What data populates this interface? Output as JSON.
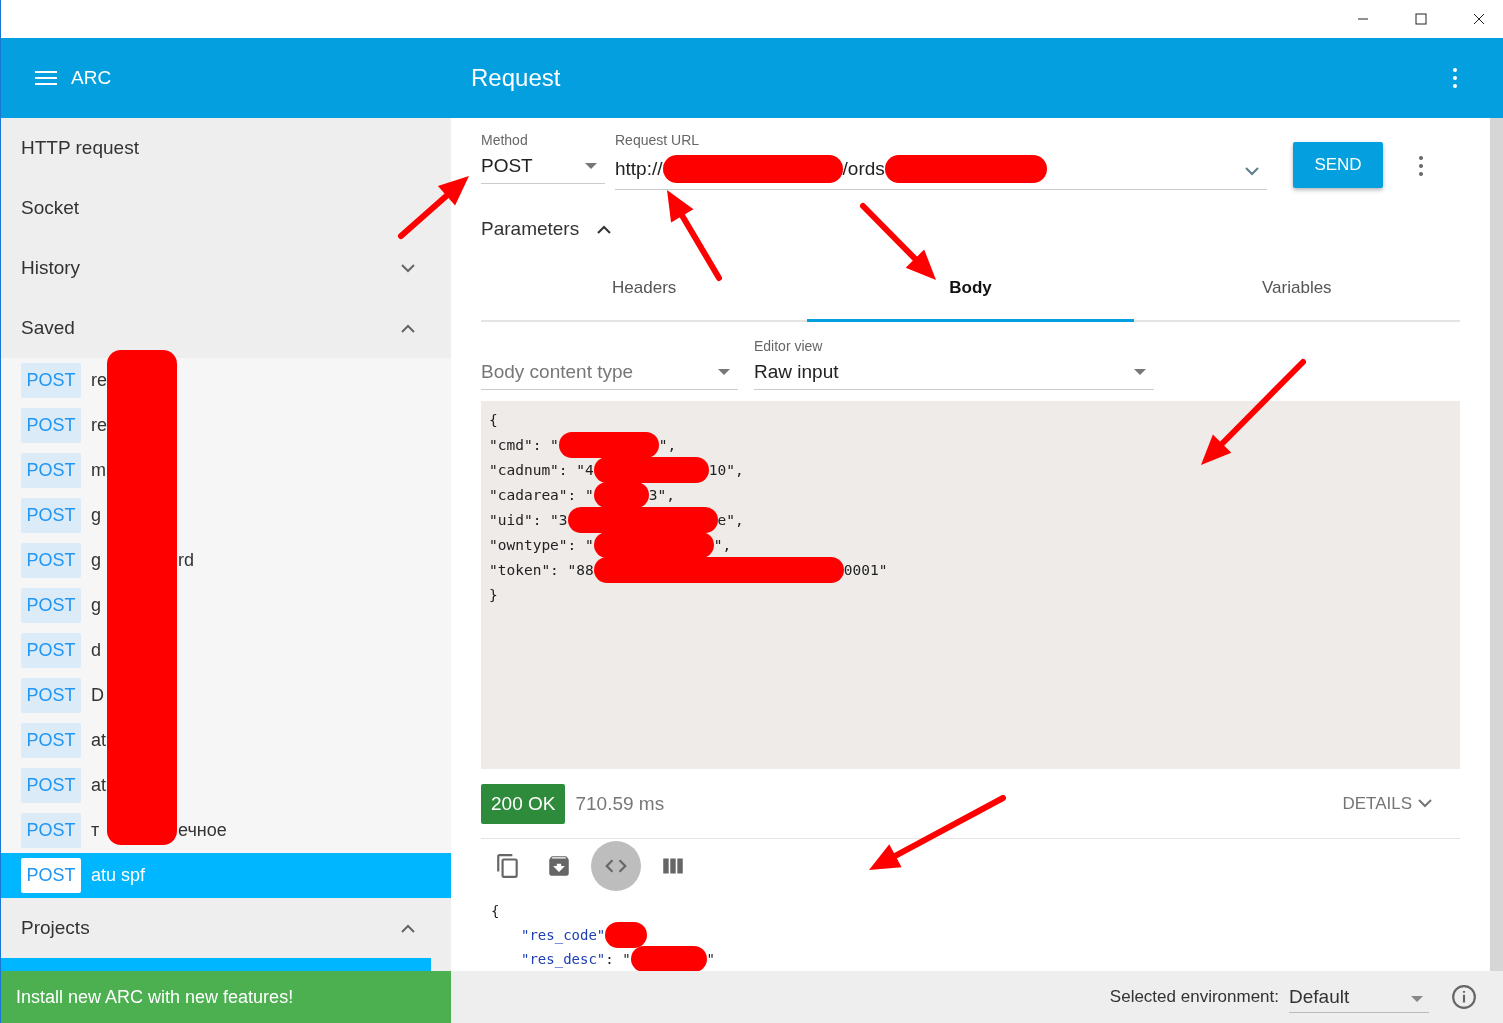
{
  "app_bar": {
    "app_name": "ARC",
    "title": "Request"
  },
  "sidebar": {
    "items": [
      {
        "label": "HTTP request",
        "kind": "plain"
      },
      {
        "label": "Socket",
        "kind": "plain"
      },
      {
        "label": "History",
        "kind": "group",
        "expanded": false
      },
      {
        "label": "Saved",
        "kind": "group",
        "expanded": true
      }
    ],
    "saved": [
      {
        "method": "POST",
        "name": "re",
        "selected": false
      },
      {
        "method": "POST",
        "name": "re",
        "selected": false
      },
      {
        "method": "POST",
        "name": "m",
        "selected": false
      },
      {
        "method": "POST",
        "name": "g",
        "selected": false
      },
      {
        "method": "POST",
        "name": "g",
        "name_tail": "rd",
        "selected": false
      },
      {
        "method": "POST",
        "name": "g",
        "selected": false
      },
      {
        "method": "POST",
        "name": "d",
        "selected": false
      },
      {
        "method": "POST",
        "name": "D",
        "selected": false
      },
      {
        "method": "POST",
        "name": "at",
        "selected": false
      },
      {
        "method": "POST",
        "name": "at",
        "selected": false
      },
      {
        "method": "POST",
        "name": "т",
        "name_tail": "ечное",
        "selected": false
      },
      {
        "method": "POST",
        "name": "atu spf",
        "selected": true
      }
    ],
    "projects": {
      "label": "Projects",
      "expanded": true
    },
    "banner": "Install new ARC with new features!"
  },
  "request": {
    "method_label": "Method",
    "method": "POST",
    "url_label": "Request URL",
    "url_parts": [
      "http://",
      "/ords"
    ],
    "send": "SEND",
    "parameters": {
      "label": "Parameters",
      "expanded": true
    },
    "tabs": [
      {
        "label": "Headers",
        "selected": false
      },
      {
        "label": "Body",
        "selected": true
      },
      {
        "label": "Variables",
        "selected": false
      }
    ],
    "content_type": {
      "placeholder": "Body content type"
    },
    "editor_view": {
      "label": "Editor view",
      "value": "Raw input"
    },
    "body_lines": [
      {
        "head": "{"
      },
      {
        "head": "\"cmd\": \"",
        "tail": "\",",
        "redacted": true
      },
      {
        "head": "\"cadnum\": \"4",
        "tail": "10\",",
        "redacted": true
      },
      {
        "head": "\"cadarea\": \"",
        "tail": "3\",",
        "redacted": true
      },
      {
        "head": "\"uid\": \"3",
        "tail": "e\",",
        "redacted": true
      },
      {
        "head": "\"owntype\": \"",
        "tail": "\",",
        "redacted": true
      },
      {
        "head": "\"token\": \"88",
        "tail": "0001\"",
        "redacted": true
      },
      {
        "head": "}"
      }
    ]
  },
  "response": {
    "status": "200 OK",
    "time": "710.59 ms",
    "details": "DETAILS",
    "tools": [
      {
        "kind": "copy",
        "selected": false
      },
      {
        "kind": "save",
        "selected": false
      },
      {
        "kind": "code",
        "selected": true
      },
      {
        "kind": "columns",
        "selected": false
      }
    ],
    "lines": [
      {
        "head": "{"
      },
      {
        "key": "\"res_code\"",
        "redacted": true
      },
      {
        "key": "\"res_desc\"",
        "punct": ": \"",
        "tail": "\"",
        "redacted": true
      }
    ]
  },
  "status_bar": {
    "env_label": "Selected environment:",
    "env_value": "Default"
  }
}
